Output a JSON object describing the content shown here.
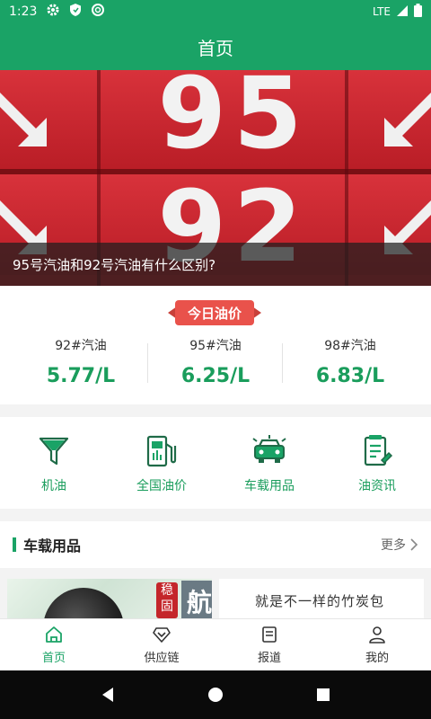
{
  "status_bar": {
    "time": "1:23",
    "network": "LTE"
  },
  "app_bar": {
    "title": "首页"
  },
  "banner": {
    "caption": "95号汽油和92号汽油有什么区别?",
    "numbers": [
      "95",
      "92"
    ]
  },
  "today_price": {
    "ribbon_label": "今日油价",
    "items": [
      {
        "name": "92#汽油",
        "value": "5.77/L"
      },
      {
        "name": "95#汽油",
        "value": "6.25/L"
      },
      {
        "name": "98#汽油",
        "value": "6.83/L"
      }
    ]
  },
  "quick_menu": [
    {
      "label": "机油",
      "icon": "funnel-icon"
    },
    {
      "label": "全国油价",
      "icon": "fuel-pump-icon"
    },
    {
      "label": "车载用品",
      "icon": "car-icon"
    },
    {
      "label": "油资讯",
      "icon": "news-icon"
    }
  ],
  "section": {
    "title": "车载用品",
    "more": "更多"
  },
  "products": {
    "a": {
      "tag": "稳固",
      "big": "航"
    },
    "b": {
      "text": "就是不一样的竹炭包"
    }
  },
  "tabbar": [
    {
      "label": "首页",
      "icon": "home-icon",
      "active": true
    },
    {
      "label": "供应链",
      "icon": "diamond-icon",
      "active": false
    },
    {
      "label": "报道",
      "icon": "report-icon",
      "active": false
    },
    {
      "label": "我的",
      "icon": "person-icon",
      "active": false
    }
  ],
  "colors": {
    "brand": "#1aa366",
    "price": "#1a9d5c",
    "ribbon": "#e9524b"
  }
}
